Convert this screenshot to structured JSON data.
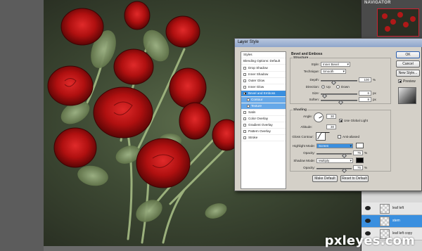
{
  "navigator": {
    "tab": "NAVIGATOR"
  },
  "dialog": {
    "title": "Layer Style",
    "close_glyph": "×",
    "styles_header": "Styles",
    "blending_options": "Blending Options: Default",
    "effects": [
      {
        "label": "Drop Shadow",
        "checked": false
      },
      {
        "label": "Inner Shadow",
        "checked": false
      },
      {
        "label": "Outer Glow",
        "checked": false
      },
      {
        "label": "Inner Glow",
        "checked": false
      },
      {
        "label": "Bevel and Emboss",
        "checked": true,
        "active": true
      },
      {
        "label": "Contour",
        "checked": false,
        "sub": true
      },
      {
        "label": "Texture",
        "checked": false,
        "sub": true
      },
      {
        "label": "Satin",
        "checked": false
      },
      {
        "label": "Color Overlay",
        "checked": false
      },
      {
        "label": "Gradient Overlay",
        "checked": false
      },
      {
        "label": "Pattern Overlay",
        "checked": false
      },
      {
        "label": "Stroke",
        "checked": false
      }
    ],
    "bevel": {
      "title": "Bevel and Emboss",
      "structure": "Structure",
      "style_label": "Style:",
      "style_value": "Inner Bevel",
      "technique_label": "Technique:",
      "technique_value": "Smooth",
      "depth_label": "Depth:",
      "depth_value": "100",
      "depth_unit": "%",
      "direction_label": "Direction:",
      "direction_up": "Up",
      "direction_down": "Down",
      "size_label": "Size:",
      "size_value": "6",
      "size_unit": "px",
      "soften_label": "Soften:",
      "soften_value": "8",
      "soften_unit": "px"
    },
    "shading": {
      "title": "Shading",
      "angle_label": "Angle:",
      "angle_value": "30",
      "use_global_light": "Use Global Light",
      "altitude_label": "Altitude:",
      "altitude_value": "30",
      "gloss_contour_label": "Gloss Contour:",
      "anti_aliased": "Anti-aliased",
      "highlight_mode_label": "Highlight Mode:",
      "highlight_mode_value": "Screen",
      "highlight_color": "#ffffff",
      "opacity_label": "Opacity:",
      "highlight_opacity": "75",
      "shadow_mode_label": "Shadow Mode:",
      "shadow_mode_value": "Multiply",
      "shadow_color": "#000000",
      "shadow_opacity": "75",
      "percent": "%"
    },
    "buttons": {
      "make_default": "Make Default",
      "reset_default": "Reset to Default",
      "ok": "OK",
      "cancel": "Cancel",
      "new_style": "New Style...",
      "preview": "Preview"
    }
  },
  "layers": [
    {
      "name": "leaf left",
      "selected": false
    },
    {
      "name": "stem",
      "selected": true
    },
    {
      "name": "leaf left copy",
      "selected": false
    }
  ],
  "watermark": "pxleyes.com"
}
